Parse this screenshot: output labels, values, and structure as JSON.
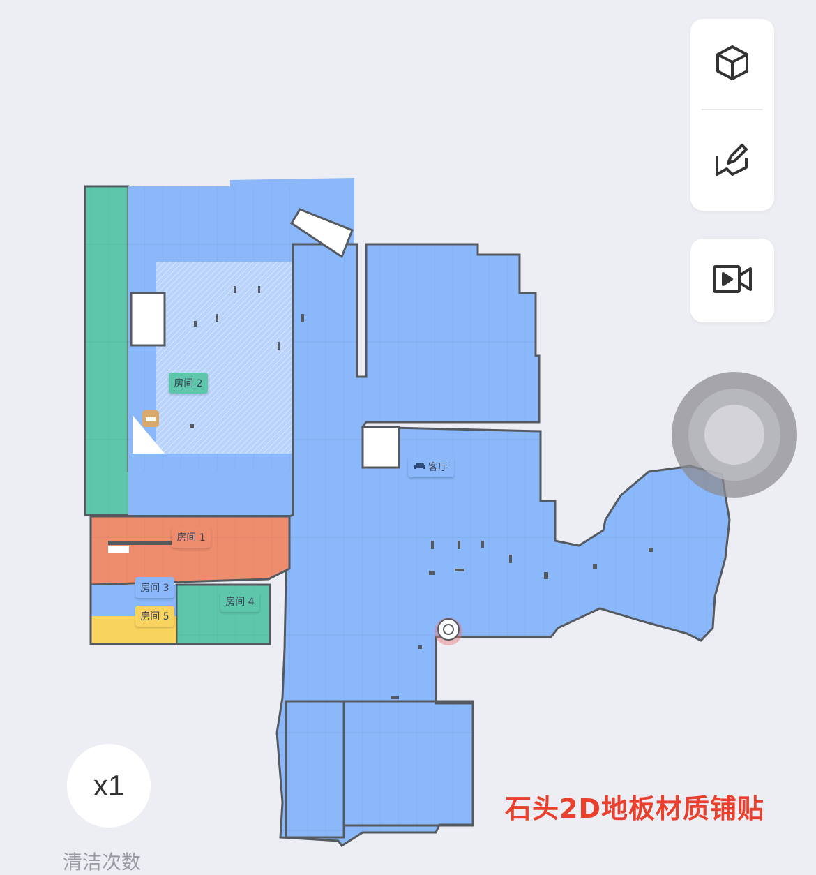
{
  "map": {
    "rooms": [
      {
        "id": "room2",
        "label": "房间 2",
        "color": "#5ec7ab",
        "icon": "bed-icon"
      },
      {
        "id": "living",
        "label": "客厅",
        "color": "#8ab8fa",
        "icon": "sofa-icon"
      },
      {
        "id": "room1",
        "label": "房间 1",
        "color": "#ee8c6e"
      },
      {
        "id": "room3",
        "label": "房间 3",
        "color": "#8ab8fa"
      },
      {
        "id": "room4",
        "label": "房间 4",
        "color": "#5ec7ab"
      },
      {
        "id": "room5",
        "label": "房间 5",
        "color": "#f8d35e"
      }
    ],
    "robot_icon": "robot-icon",
    "furniture_icon": "bed-icon"
  },
  "toolbar": {
    "view3d_icon": "cube-icon",
    "edit_icon": "edit-map-icon",
    "video_icon": "video-camera-icon"
  },
  "controls": {
    "clean_count_value": "x1",
    "clean_count_label": "清洁次数"
  },
  "caption": "石头2D地板材质铺贴",
  "colors": {
    "background": "#edeef3",
    "wall": "#555a60",
    "accent_red": "#e8402c"
  }
}
